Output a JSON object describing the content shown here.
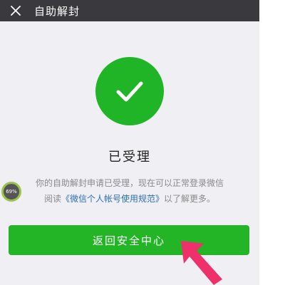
{
  "header": {
    "title": "自助解封",
    "close_icon": "close-icon"
  },
  "status": {
    "icon": "checkmark-icon",
    "icon_color": "#20b526",
    "title": "已受理"
  },
  "message": {
    "line1": "你的自助解封申请已受理，现在可以正常登录微信",
    "line2_prefix": "阅读",
    "link_text": "《微信个人帐号使用规范》",
    "line2_suffix": "以了解更多。"
  },
  "badge": {
    "text": "69%"
  },
  "actions": {
    "back_button_label": "返回安全中心",
    "button_color": "#23b526"
  },
  "annotation": {
    "arrow_color": "#f0306a"
  }
}
